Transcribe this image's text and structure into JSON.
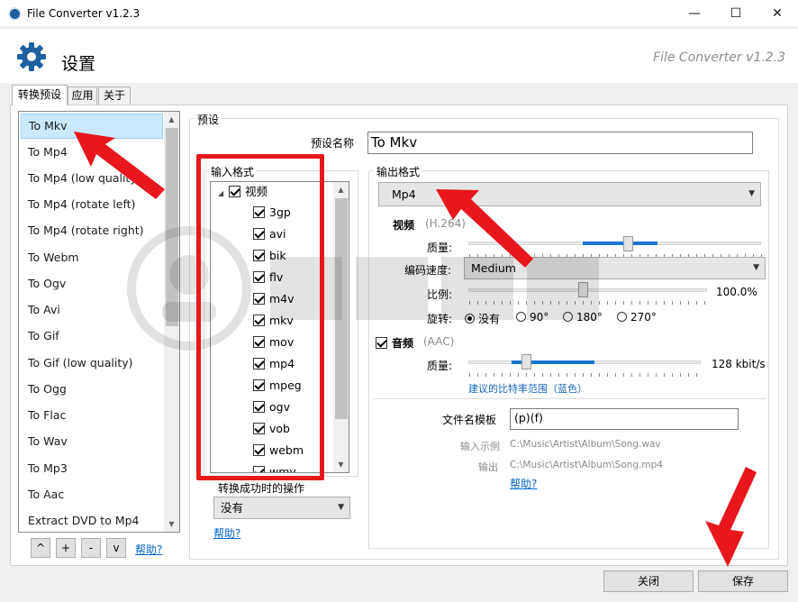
{
  "window": {
    "title": "File Converter v1.2.3",
    "minimize": "—",
    "maximize": "☐",
    "close": "✕"
  },
  "header": {
    "title": "设置",
    "brand": "File Converter v1.2.3"
  },
  "tabs": [
    {
      "label": "转换预设",
      "active": true
    },
    {
      "label": "应用",
      "active": false
    },
    {
      "label": "关于",
      "active": false
    }
  ],
  "presets": [
    "To Mkv",
    "To Mp4",
    "To Mp4 (low quality)",
    "To Mp4 (rotate left)",
    "To Mp4 (rotate right)",
    "To Webm",
    "To Ogv",
    "To Avi",
    "To Gif",
    "To Gif (low quality)",
    "To Ogg",
    "To Flac",
    "To Wav",
    "To Mp3",
    "To Aac",
    "Extract DVD to Mp4"
  ],
  "list_buttons": {
    "up": "^",
    "add": "+",
    "remove": "-",
    "down": "v",
    "help": "帮助?"
  },
  "preset_group": {
    "label": "预设",
    "name_label": "预设名称",
    "name_value": "To Mkv"
  },
  "input_formats": {
    "label": "输入格式",
    "category": "视频",
    "formats": [
      "3gp",
      "avi",
      "bik",
      "flv",
      "m4v",
      "mkv",
      "mov",
      "mp4",
      "mpeg",
      "ogv",
      "vob",
      "webm",
      "wmv"
    ]
  },
  "after_conversion": {
    "label": "转换成功时的操作",
    "value": "没有",
    "help": "帮助?"
  },
  "output": {
    "label": "输出格式",
    "format": "Mp4",
    "video_label": "视频",
    "video_codec": "(H.264)",
    "quality_label": "质量:",
    "encode_speed_label": "编码速度:",
    "encode_speed": "Medium",
    "scale_label": "比例:",
    "scale_value": "100.0%",
    "rotate_label": "旋转:",
    "rotate_options": [
      "没有",
      "90°",
      "180°",
      "270°"
    ],
    "rotate_selected": 0,
    "audio_label": "音频",
    "audio_codec": "(AAC)",
    "audio_quality_label": "质量:",
    "audio_quality_value": "128 kbit/s",
    "recommended_note": "建议的比特率范围（蓝色）",
    "filename_template_label": "文件名模板",
    "filename_template": "(p)(f)",
    "input_example_label": "输入示例",
    "input_example": "C:\\Music\\Artist\\Album\\Song.wav",
    "output_label": "输出",
    "output_example": "C:\\Music\\Artist\\Album\\Song.mp4",
    "help": "帮助?"
  },
  "footer": {
    "close": "关闭",
    "save": "保存"
  },
  "colors": {
    "accent": "#1976d2",
    "annotation": "#e8171c",
    "selection": "#cce8ff"
  },
  "icons": {
    "app": "file-converter-icon",
    "settings": "gear-icon"
  }
}
